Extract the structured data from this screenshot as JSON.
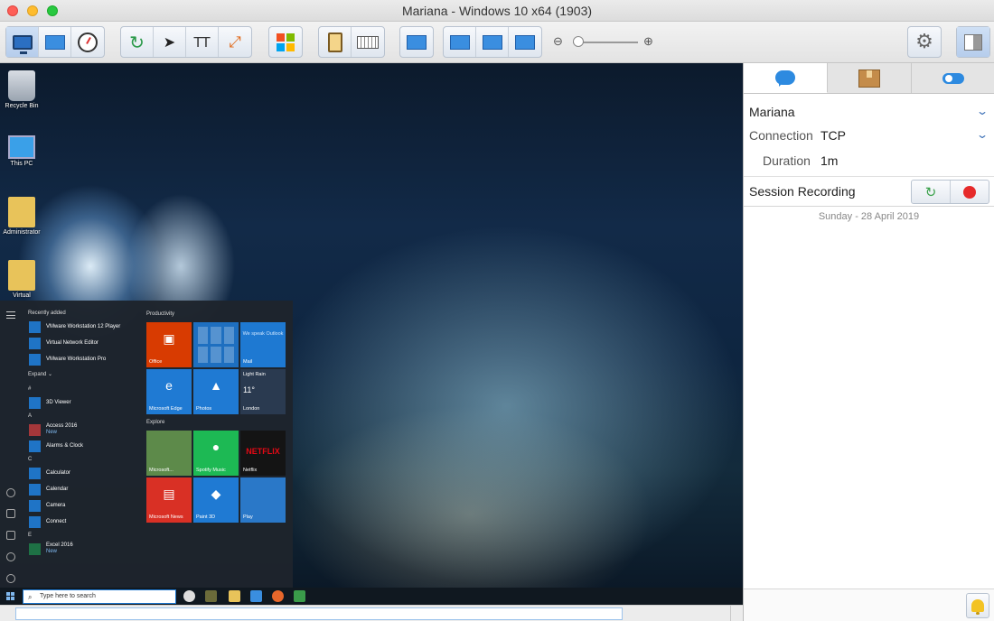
{
  "window": {
    "title": "Mariana - Windows 10 x64 (1903)"
  },
  "toolbar": {
    "icons": [
      "monitor-icon",
      "file-transfer-icon",
      "gauge-icon",
      "refresh-icon",
      "cursor-icon",
      "text-icon",
      "fullscreen-icon",
      "windows-logo-icon",
      "clipboard-icon",
      "keyboard-icon",
      "display-icon",
      "fit-width-icon",
      "fit-height-icon",
      "fit-window-icon",
      "zoom-out-icon",
      "zoom-in-icon",
      "gear-icon",
      "side-panel-icon"
    ],
    "text_icon_glyph": "TT",
    "zoom_out_glyph": "⊖",
    "zoom_in_glyph": "⊕",
    "zoom_level": 0,
    "gear_glyph": "⚙"
  },
  "desktop": {
    "icons": [
      {
        "label": "Recycle Bin"
      },
      {
        "label": "This PC"
      },
      {
        "label": "Administrator"
      },
      {
        "label": "Virtual"
      }
    ]
  },
  "start_menu": {
    "recently_added_header": "Recently added",
    "recent_apps": [
      "VMware Workstation 12 Player",
      "Virtual Network Editor",
      "VMware Workstation Pro"
    ],
    "expand_label": "Expand",
    "sections": [
      {
        "letter": "#",
        "apps": [
          {
            "name": "3D Viewer",
            "badge": ""
          }
        ]
      },
      {
        "letter": "A",
        "apps": [
          {
            "name": "Access 2016",
            "badge": "New"
          },
          {
            "name": "Alarms & Clock",
            "badge": ""
          }
        ]
      },
      {
        "letter": "C",
        "apps": [
          {
            "name": "Calculator",
            "badge": ""
          },
          {
            "name": "Calendar",
            "badge": ""
          },
          {
            "name": "Camera",
            "badge": ""
          },
          {
            "name": "Connect",
            "badge": ""
          }
        ]
      },
      {
        "letter": "E",
        "apps": [
          {
            "name": "Excel 2016",
            "badge": "New"
          }
        ]
      }
    ],
    "productivity_header": "Productivity",
    "explore_header": "Explore",
    "tiles": {
      "office": "Office",
      "mail_promo": "We speak Outlook",
      "mail": "Mail",
      "edge": "Microsoft Edge",
      "photos": "Photos",
      "weather_cond": "Light Rain",
      "weather_temp": "11°",
      "weather_city": "London",
      "minecraft": "Microsoft...",
      "spotify": "Spotify Music",
      "netflix": "Netflix",
      "netflix_logo": "NETFLIX",
      "news": "Microsoft News",
      "paint3d": "Paint 3D",
      "play": "Play"
    }
  },
  "taskbar": {
    "search_placeholder": "Type here to search",
    "search_glyph": "⌕"
  },
  "session_panel": {
    "tabs": [
      "chat-icon",
      "package-icon",
      "toggle-icon"
    ],
    "computer_name": "Mariana",
    "connection_label": "Connection",
    "connection_value": "TCP",
    "duration_label": "Duration",
    "duration_value": "1m",
    "recording_label": "Session Recording",
    "date_text": "Sunday  -  28 April 2019",
    "chevron_glyph": "⌄",
    "refresh_glyph": "↻"
  },
  "colors": {
    "accent": "#2d8ae0",
    "record": "#e62a2a",
    "office_tile": "#d83b01",
    "netflix": "#e50914"
  }
}
